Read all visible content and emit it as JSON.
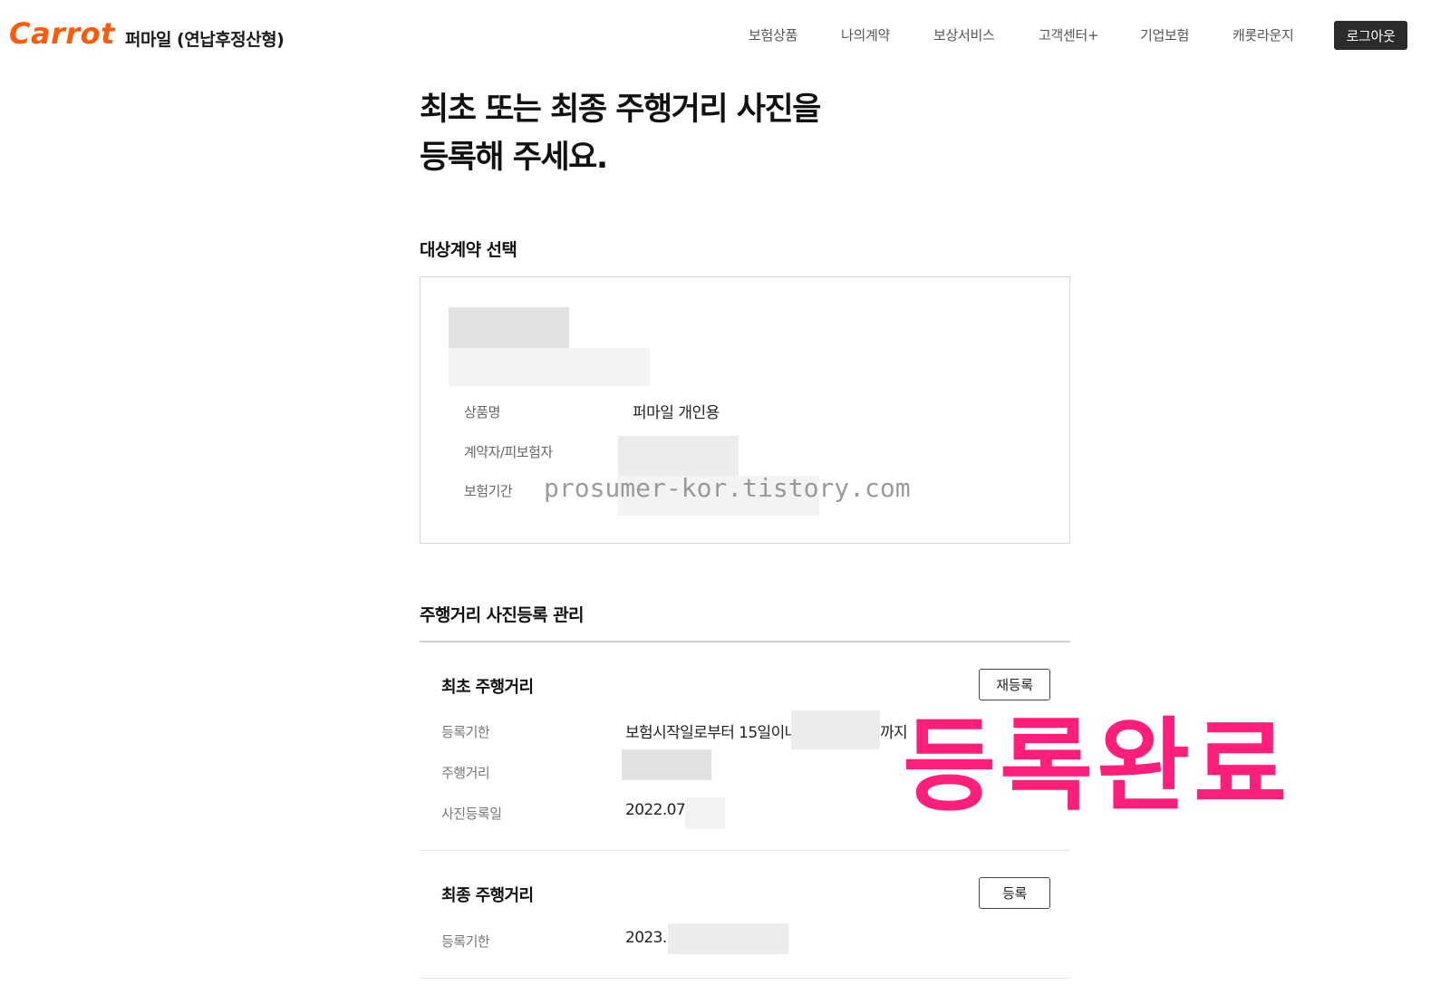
{
  "header": {
    "logo": "Carrot",
    "product_name": "퍼마일 (연납후정산형)",
    "nav": [
      "보험상품",
      "나의계약",
      "보상서비스",
      "고객센터+",
      "기업보험",
      "캐롯라운지"
    ],
    "logout_label": "로그아웃"
  },
  "page": {
    "title_line1": "최초 또는 최종 주행거리 사진을",
    "title_line2": "등록해 주세요."
  },
  "contract": {
    "section_title": "대상계약 선택",
    "rows": [
      {
        "label": "상품명",
        "value": "퍼마일 개인용"
      },
      {
        "label": "계약자/피보험자",
        "value": ""
      },
      {
        "label": "보험기간",
        "value": ""
      }
    ]
  },
  "mileage": {
    "section_title": "주행거리 사진등록 관리",
    "first": {
      "title": "최초 주행거리",
      "button": "재등록",
      "rows": [
        {
          "label": "등록기한",
          "value": "보험시작일로부터 15일이나",
          "suffix": "까지"
        },
        {
          "label": "주행거리",
          "value": ""
        },
        {
          "label": "사진등록일",
          "value": "2022.07."
        }
      ]
    },
    "final": {
      "title": "최종 주행거리",
      "button": "등록",
      "rows": [
        {
          "label": "등록기한",
          "value": "2023."
        }
      ]
    }
  },
  "overlay": {
    "watermark": "prosumer-kor.tistory.com",
    "stamp": "등록완료",
    "stamp_color": "#ff1f7a",
    "brand_color": "#ff5a0a"
  }
}
